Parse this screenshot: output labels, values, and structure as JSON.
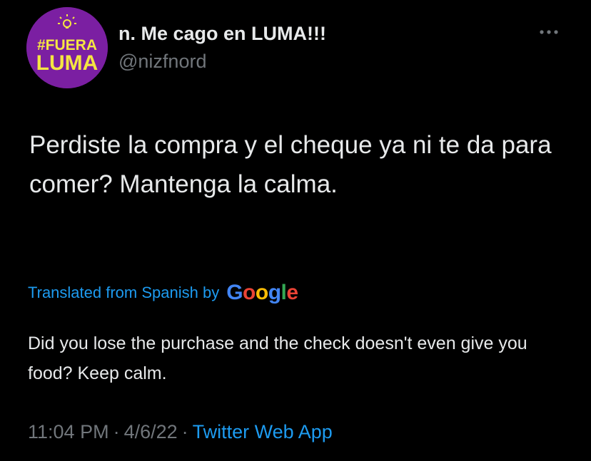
{
  "author": {
    "display_name": "n. Me cago en LUMA!!!",
    "handle": "@nizfnord",
    "avatar": {
      "line1": "#FUERA",
      "line2": "LUMA",
      "background": "#7b1fa2",
      "text_color": "#f5e642"
    }
  },
  "tweet": {
    "text": "Perdiste la compra y el cheque ya ni te da para comer? Mantenga la calma.",
    "translated_label": "Translated from Spanish by",
    "translator_logo": [
      "G",
      "o",
      "o",
      "g",
      "l",
      "e"
    ],
    "translation": "Did you lose the purchase and the check doesn't even give you food? Keep calm."
  },
  "meta": {
    "time": "11:04 PM",
    "sep1": "·",
    "date": "4/6/22",
    "sep2": "·",
    "source": "Twitter Web App"
  },
  "icons": {
    "more": "more-horizontal-icon",
    "bulb": "lightbulb-icon"
  },
  "colors": {
    "background": "#000000",
    "primary_text": "#e7e9ea",
    "secondary_text": "#71767b",
    "accent": "#1d9bf0"
  }
}
